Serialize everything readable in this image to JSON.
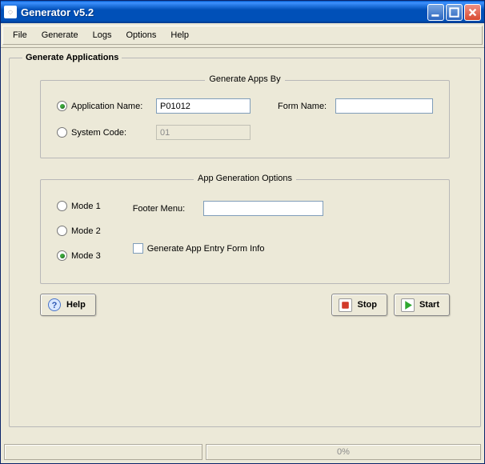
{
  "window": {
    "title": "Generator v5.2"
  },
  "menu": {
    "file": "File",
    "generate": "Generate",
    "logs": "Logs",
    "options": "Options",
    "help": "Help"
  },
  "outer_group": {
    "legend": "Generate Applications"
  },
  "gen_by": {
    "legend": "Generate Apps By",
    "app_name_label": "Application Name:",
    "app_name_value": "P01012",
    "form_name_label": "Form Name:",
    "form_name_value": "",
    "system_code_label": "System Code:",
    "system_code_value": "01"
  },
  "gen_opts": {
    "legend": "App Generation Options",
    "mode1": "Mode 1",
    "mode2": "Mode 2",
    "mode3": "Mode 3",
    "footer_menu_label": "Footer Menu:",
    "footer_menu_value": "",
    "gen_entry_label": "Generate App Entry Form Info"
  },
  "buttons": {
    "help": "Help",
    "stop": "Stop",
    "start": "Start"
  },
  "status": {
    "progress_text": "0%"
  }
}
